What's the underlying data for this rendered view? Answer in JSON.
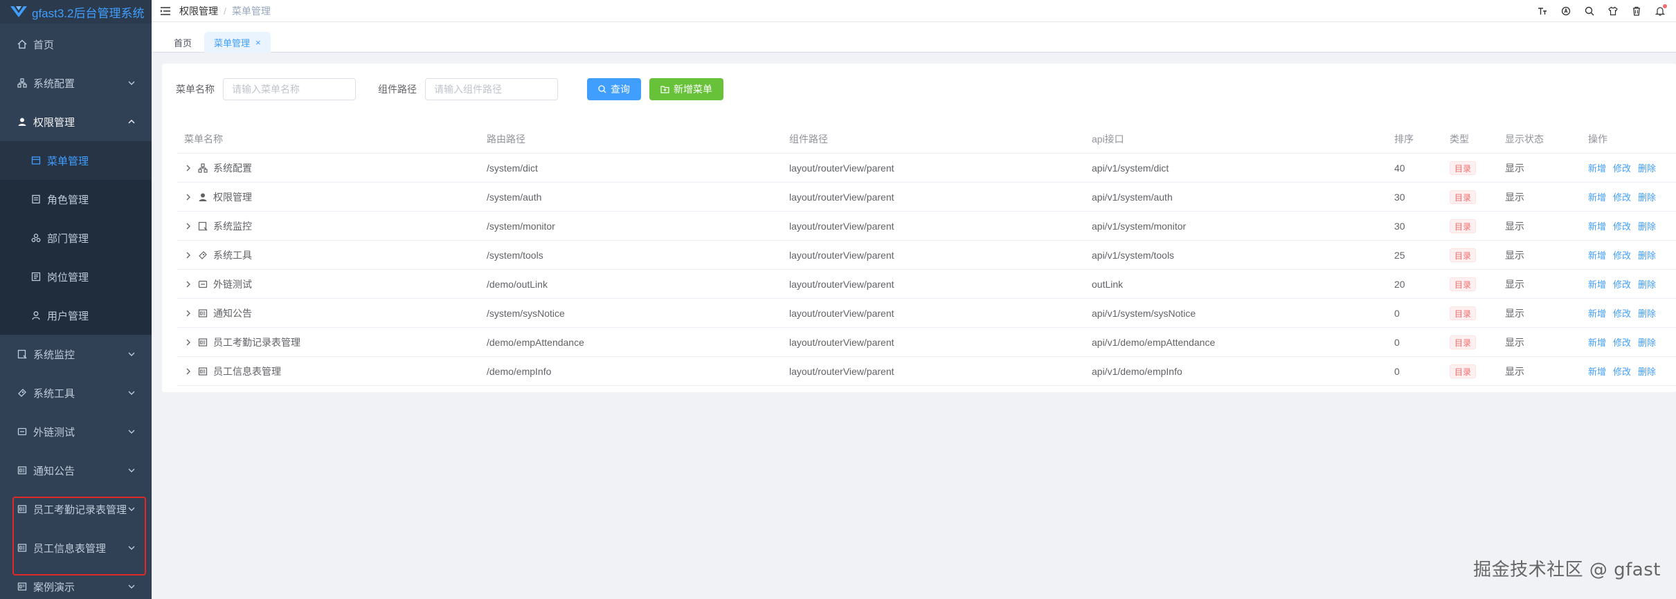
{
  "app": {
    "title": "gfast3.2后台管理系统"
  },
  "sidebar": {
    "items": [
      {
        "label": "首页",
        "icon": "home-icon"
      },
      {
        "label": "系统配置",
        "icon": "system-config-icon"
      },
      {
        "label": "权限管理",
        "icon": "user-icon"
      },
      {
        "label": "菜单管理",
        "icon": "menu-icon"
      },
      {
        "label": "角色管理",
        "icon": "role-icon"
      },
      {
        "label": "部门管理",
        "icon": "department-icon"
      },
      {
        "label": "岗位管理",
        "icon": "post-icon"
      },
      {
        "label": "用户管理",
        "icon": "user-outline-icon"
      },
      {
        "label": "系统监控",
        "icon": "monitor-icon"
      },
      {
        "label": "系统工具",
        "icon": "tools-icon"
      },
      {
        "label": "外链测试",
        "icon": "link-icon"
      },
      {
        "label": "通知公告",
        "icon": "notice-icon"
      },
      {
        "label": "员工考勤记录表管理",
        "icon": "list-icon"
      },
      {
        "label": "员工信息表管理",
        "icon": "list-icon"
      },
      {
        "label": "案例演示",
        "icon": "list-icon"
      }
    ]
  },
  "breadcrumb": {
    "parent": "权限管理",
    "sep": "/",
    "current": "菜单管理"
  },
  "tags": {
    "home": "首页",
    "current": "菜单管理",
    "close": "×"
  },
  "search": {
    "menu_name_label": "菜单名称",
    "menu_name_placeholder": "请输入菜单名称",
    "component_label": "组件路径",
    "component_placeholder": "请输入组件路径",
    "query_button": "查询",
    "add_button": "新增菜单"
  },
  "table": {
    "headers": {
      "name": "菜单名称",
      "path": "路由路径",
      "component": "组件路径",
      "api": "api接口",
      "sort": "排序",
      "type": "类型",
      "show": "显示状态",
      "ops": "操作"
    },
    "ops": {
      "add": "新增",
      "edit": "修改",
      "delete": "删除"
    },
    "rows": [
      {
        "name": "系统配置",
        "path": "/system/dict",
        "component": "layout/routerView/parent",
        "api": "api/v1/system/dict",
        "sort": "40",
        "type": "目录",
        "show": "显示"
      },
      {
        "name": "权限管理",
        "path": "/system/auth",
        "component": "layout/routerView/parent",
        "api": "api/v1/system/auth",
        "sort": "30",
        "type": "目录",
        "show": "显示"
      },
      {
        "name": "系统监控",
        "path": "/system/monitor",
        "component": "layout/routerView/parent",
        "api": "api/v1/system/monitor",
        "sort": "30",
        "type": "目录",
        "show": "显示"
      },
      {
        "name": "系统工具",
        "path": "/system/tools",
        "component": "layout/routerView/parent",
        "api": "api/v1/system/tools",
        "sort": "25",
        "type": "目录",
        "show": "显示"
      },
      {
        "name": "外链测试",
        "path": "/demo/outLink",
        "component": "layout/routerView/parent",
        "api": "outLink",
        "sort": "20",
        "type": "目录",
        "show": "显示"
      },
      {
        "name": "通知公告",
        "path": "/system/sysNotice",
        "component": "layout/routerView/parent",
        "api": "api/v1/system/sysNotice",
        "sort": "0",
        "type": "目录",
        "show": "显示"
      },
      {
        "name": "员工考勤记录表管理",
        "path": "/demo/empAttendance",
        "component": "layout/routerView/parent",
        "api": "api/v1/demo/empAttendance",
        "sort": "0",
        "type": "目录",
        "show": "显示"
      },
      {
        "name": "员工信息表管理",
        "path": "/demo/empInfo",
        "component": "layout/routerView/parent",
        "api": "api/v1/demo/empInfo",
        "sort": "0",
        "type": "目录",
        "show": "显示"
      }
    ]
  },
  "watermark": "掘金技术社区 @ gfast",
  "colors": {
    "sidebar_bg": "#304156",
    "primary": "#409eff",
    "success": "#67c23a",
    "danger": "#f56c6c"
  }
}
